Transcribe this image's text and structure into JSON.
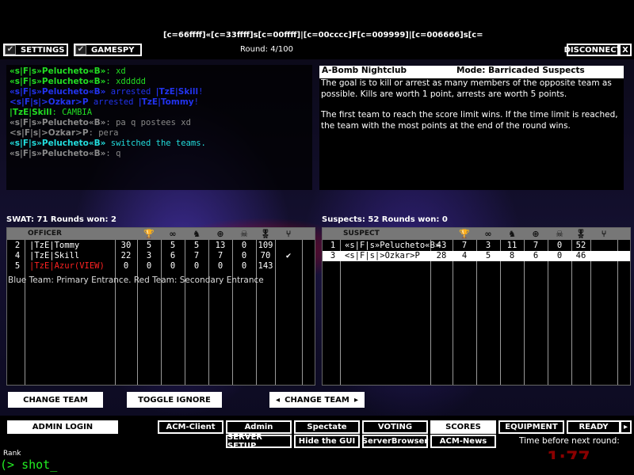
{
  "server_name": "[c=66ffff]«[c=33ffff]s[c=00ffff]|[c=00cccc]F[c=009999]|[c=006666]s[c=",
  "round": "Round: 4/100",
  "top_buttons": {
    "settings": "SETTINGS",
    "gamespy": "GAMESPY",
    "disconnect": "DISCONNECT",
    "close": "X"
  },
  "chat": [
    {
      "name": "«s|F|s»Pelucheto«B»",
      "text": ": xd",
      "color": "#22dd22"
    },
    {
      "name": "«s|F|s»Pelucheto«B»",
      "text": ": xddddd",
      "color": "#22dd22"
    },
    {
      "name": "«s|F|s»Pelucheto«B»",
      "text": " arrested ",
      "name2": "|TzE|Skill",
      "end": "!",
      "color": "#2233ee"
    },
    {
      "name": "<s|F|s|>Ozkar>P",
      "text": " arrested ",
      "name2": "|TzE|Tommy",
      "end": "!",
      "color": "#2233ee"
    },
    {
      "name": "|TzE|Skill",
      "text": ": CAMBIA",
      "color": "#22dd22"
    },
    {
      "name": "«s|F|s»Pelucheto«B»",
      "text": ": pa q postees xd",
      "color": "#888888"
    },
    {
      "name": "<s|F|s|>Ozkar>P",
      "text": ": pera",
      "color": "#888888"
    },
    {
      "name": "«s|F|s»Pelucheto«B»",
      "text": " switched the teams.",
      "color": "#22dddd"
    },
    {
      "name": "«s|F|s»Pelucheto«B»",
      "text": ": q",
      "color": "#888888"
    }
  ],
  "info": {
    "map": "A-Bomb Nightclub",
    "mode": "Mode: Barricaded Suspects",
    "p1": "The goal is to kill or arrest as many members of the opposite team as possible.  Kills are worth 1 point, arrests are worth 5 points.",
    "p2": "The first team to reach the score limit wins.  If the time limit is reached, the team with the most points at the end of the round wins."
  },
  "swat": {
    "label": "SWAT: 71   Rounds won: 2",
    "header": "OFFICER",
    "rows": [
      [
        "2",
        "|TzE|Tommy",
        "30",
        "5",
        "5",
        "5",
        "13",
        "0",
        "109",
        ""
      ],
      [
        "4",
        "|TzE|Skill",
        "22",
        "3",
        "6",
        "7",
        "7",
        "0",
        "70",
        "✔"
      ],
      [
        "5",
        "|TzE|Azur(VIEW)",
        "0",
        "0",
        "0",
        "0",
        "0",
        "0",
        "143",
        ""
      ]
    ],
    "highlight_color": "#ff2222"
  },
  "suspects": {
    "label": "Suspects: 52   Rounds won: 0",
    "header": "SUSPECT",
    "rows": [
      [
        "1",
        "«s|F|s»Pelucheto«B»",
        "43",
        "7",
        "3",
        "11",
        "7",
        "0",
        "52",
        ""
      ],
      [
        "3",
        "<s|F|s|>Ozkar>P",
        "28",
        "4",
        "5",
        "8",
        "6",
        "0",
        "46",
        ""
      ]
    ]
  },
  "stat_icons": [
    "trophy-icon",
    "handcuffs-icon",
    "arrest-icon",
    "crosshair-icon",
    "skull-icon",
    "medal-icon",
    "ping-icon"
  ],
  "entrance_note": "Blue Team: Primary Entrance. Red Team: Secondary Entrance",
  "buttons": {
    "change_team": "CHANGE TEAM",
    "toggle_ignore": "TOGGLE IGNORE",
    "change_team2": "CHANGE TEAM",
    "admin_login": "ADMIN LOGIN",
    "acm_client": "ACM-Client",
    "admin": "Admin",
    "spectate": "Spectate",
    "voting": "VOTING",
    "scores": "SCORES",
    "equipment": "EQUIPMENT",
    "ready": "READY",
    "server_setup": "SERVER SETUP",
    "hide_gui": "Hide the GUI",
    "server_browser": "ServerBrowser",
    "acm_news": "ACM-News"
  },
  "timer_label": "Time before next round:",
  "timer": "1:77",
  "rank_label": "Rank",
  "console": "(> shot_"
}
